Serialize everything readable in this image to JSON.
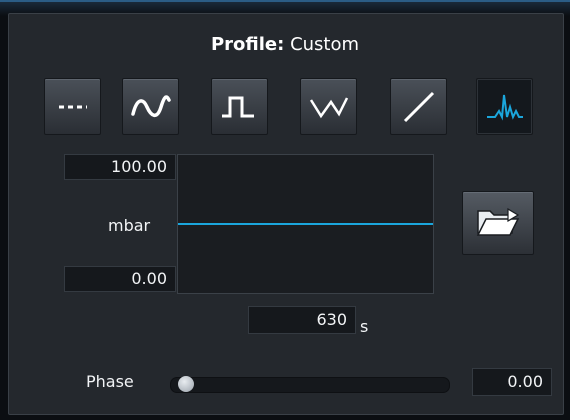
{
  "profile": {
    "label": "Profile:",
    "value": "Custom"
  },
  "waveforms": [
    {
      "name": "constant",
      "icon": "dashed-line-icon"
    },
    {
      "name": "sine",
      "icon": "sine-wave-icon"
    },
    {
      "name": "square",
      "icon": "square-wave-icon"
    },
    {
      "name": "triangle",
      "icon": "triangle-wave-icon"
    },
    {
      "name": "ramp",
      "icon": "ramp-icon"
    },
    {
      "name": "custom",
      "icon": "custom-peaks-icon",
      "active": true
    }
  ],
  "plot": {
    "max": "100.00",
    "min": "0.00",
    "unit": "mbar",
    "line_color": "#1ba6dc"
  },
  "duration": {
    "value": "630",
    "unit": "s"
  },
  "load_button": {
    "icon": "folder-open-icon"
  },
  "phase": {
    "label": "Phase",
    "value": "0.00",
    "level": 0.0
  },
  "colors": {
    "accent": "#1ba6dc",
    "panel": "#24282d",
    "field": "#15181c"
  }
}
